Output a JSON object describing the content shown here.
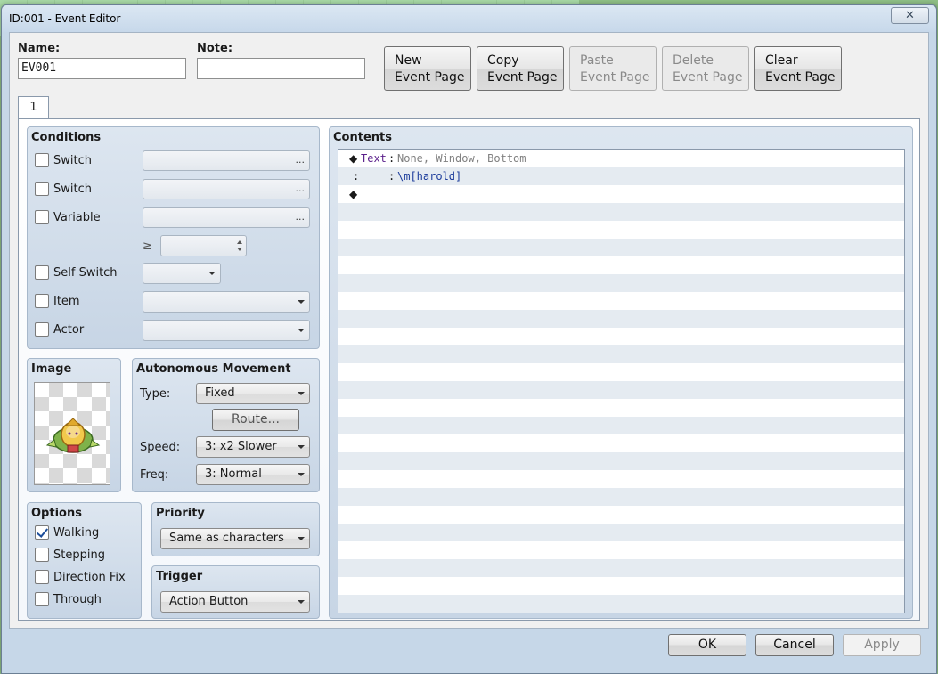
{
  "window": {
    "title": "ID:001 - Event Editor",
    "close_symbol": "✕"
  },
  "name": {
    "label": "Name:",
    "value": "EV001"
  },
  "note": {
    "label": "Note:",
    "value": ""
  },
  "page_buttons": [
    {
      "line1": "New",
      "line2": "Event Page",
      "enabled": true
    },
    {
      "line1": "Copy",
      "line2": "Event Page",
      "enabled": true
    },
    {
      "line1": "Paste",
      "line2": "Event Page",
      "enabled": false
    },
    {
      "line1": "Delete",
      "line2": "Event Page",
      "enabled": false
    },
    {
      "line1": "Clear",
      "line2": "Event Page",
      "enabled": true
    }
  ],
  "tabs": [
    {
      "label": "1"
    }
  ],
  "conditions": {
    "title": "Conditions",
    "switch1": {
      "label": "Switch",
      "checked": false,
      "value": ""
    },
    "switch2": {
      "label": "Switch",
      "checked": false,
      "value": ""
    },
    "variable": {
      "label": "Variable",
      "checked": false,
      "value": ""
    },
    "compare_symbol": "≥",
    "compare_value": "",
    "self_switch": {
      "label": "Self Switch",
      "checked": false,
      "value": ""
    },
    "item": {
      "label": "Item",
      "checked": false,
      "value": ""
    },
    "actor": {
      "label": "Actor",
      "checked": false,
      "value": ""
    },
    "ellipsis": "..."
  },
  "image": {
    "title": "Image",
    "sprite_icon": "harold-character-sprite"
  },
  "autonomous_movement": {
    "title": "Autonomous Movement",
    "type_label": "Type:",
    "type_value": "Fixed",
    "route_label": "Route...",
    "speed_label": "Speed:",
    "speed_value": "3: x2 Slower",
    "freq_label": "Freq:",
    "freq_value": "3: Normal"
  },
  "options": {
    "title": "Options",
    "items": [
      {
        "label": "Walking",
        "checked": true
      },
      {
        "label": "Stepping",
        "checked": false
      },
      {
        "label": "Direction Fix",
        "checked": false
      },
      {
        "label": "Through",
        "checked": false
      }
    ]
  },
  "priority": {
    "title": "Priority",
    "value": "Same as characters"
  },
  "trigger": {
    "title": "Trigger",
    "value": "Action Button"
  },
  "contents": {
    "title": "Contents",
    "lines": [
      {
        "marker": "◆",
        "command": "Text",
        "sep": ":",
        "args": "None, Window, Bottom"
      },
      {
        "marker": ":",
        "command": "",
        "sep": ":",
        "args": "\\m[harold]"
      },
      {
        "marker": "◆",
        "command": "",
        "sep": "",
        "args": ""
      }
    ],
    "colors": {
      "command": "#5a1e8a",
      "args_gray": "#808080",
      "args_blue": "#1a3a9a"
    }
  },
  "footer": {
    "ok": "OK",
    "cancel": "Cancel",
    "apply": "Apply"
  }
}
